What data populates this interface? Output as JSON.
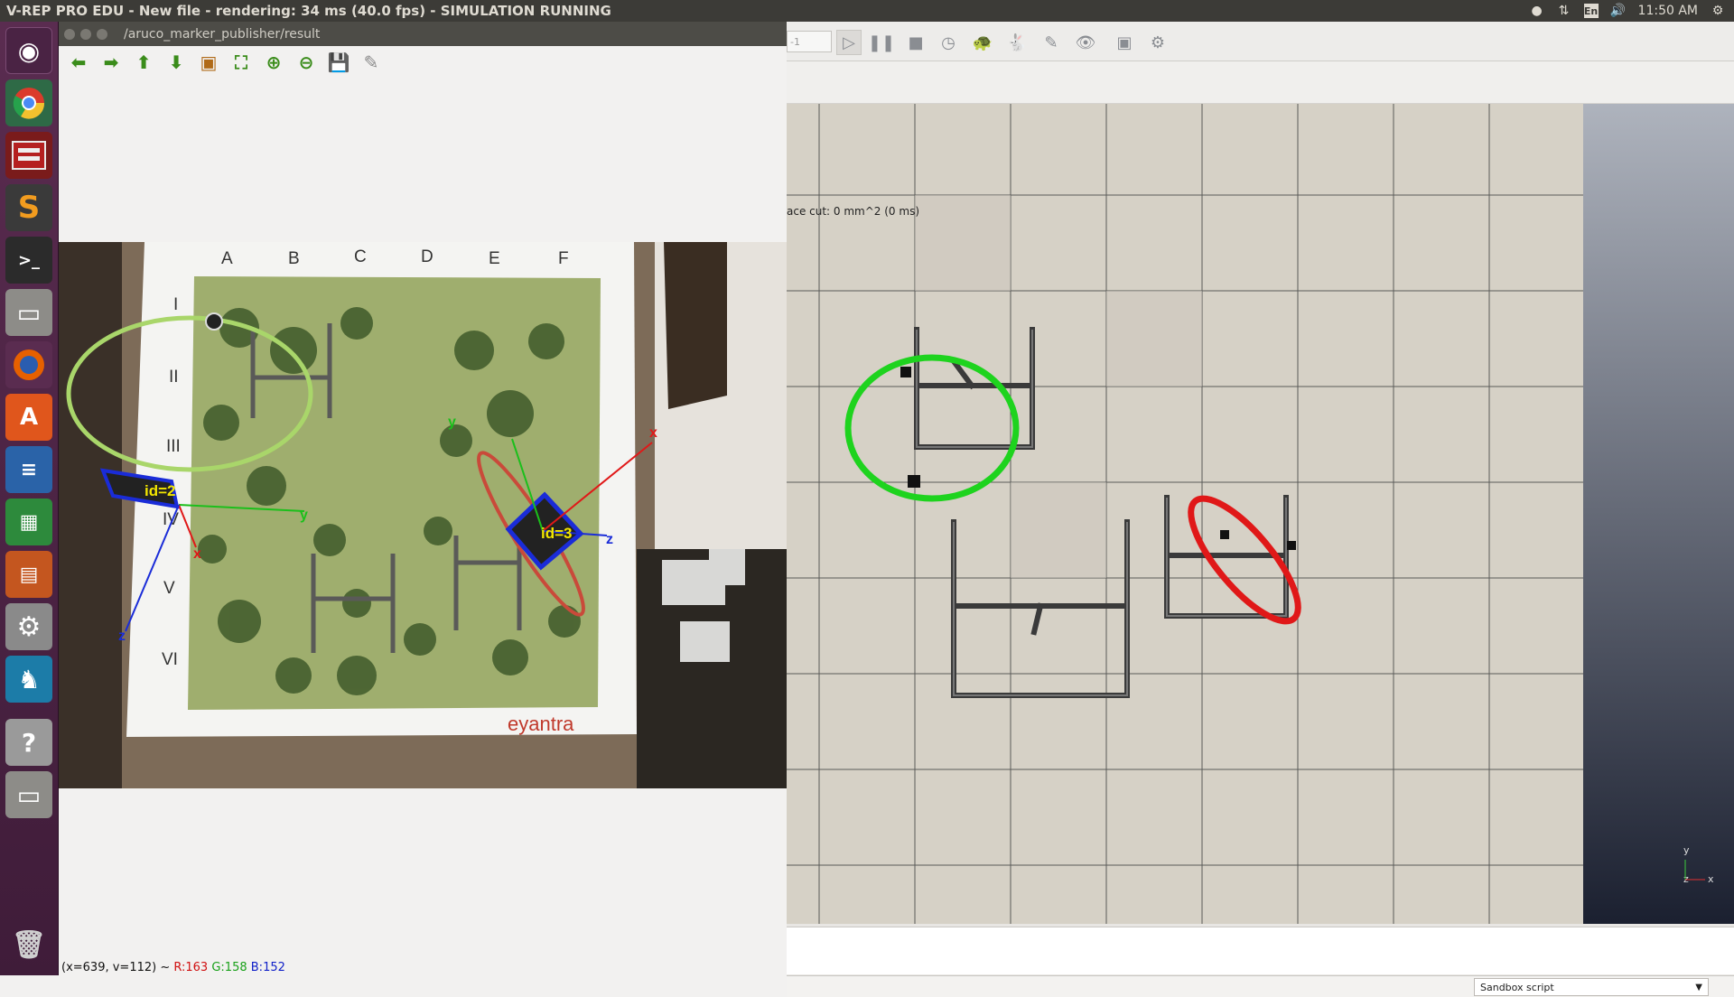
{
  "topbar": {
    "title": "V-REP PRO EDU - New file - rendering: 34 ms (40.0 fps) - SIMULATION RUNNING",
    "keyboard": "En",
    "time": "11:50 AM"
  },
  "launcher": {
    "items": [
      "ubuntu-dash",
      "chrome",
      "vrep",
      "sublime-text",
      "terminal",
      "files",
      "firefox",
      "software-center",
      "writer",
      "calc",
      "impress",
      "settings",
      "ros-turtle",
      "help",
      "files-2",
      "trash"
    ]
  },
  "rosviewer": {
    "title": "/aruco_marker_publisher/result",
    "status_coords": "(x=639, v=112) ~",
    "status_r": "R:163",
    "status_g": "G:158",
    "status_b": "B:152",
    "color_r": "#d01010",
    "color_g": "#18a018",
    "color_b": "#1020c8"
  },
  "camera": {
    "col_labels": [
      "A",
      "B",
      "C",
      "D",
      "E",
      "F"
    ],
    "row_labels": [
      "I",
      "II",
      "III",
      "IV",
      "V",
      "VI"
    ],
    "marker_left": "id=2",
    "marker_right": "id=3",
    "axis_x": "x",
    "axis_y": "y",
    "axis_z": "z",
    "logo": "eyantra"
  },
  "vrep": {
    "combo_value": "-1",
    "overlay_text": "ace cut: 0 mm^2 (0 ms)",
    "script_dropdown": "Sandbox script",
    "axis_y": "y",
    "axis_z": "z",
    "axis_x": "x"
  }
}
